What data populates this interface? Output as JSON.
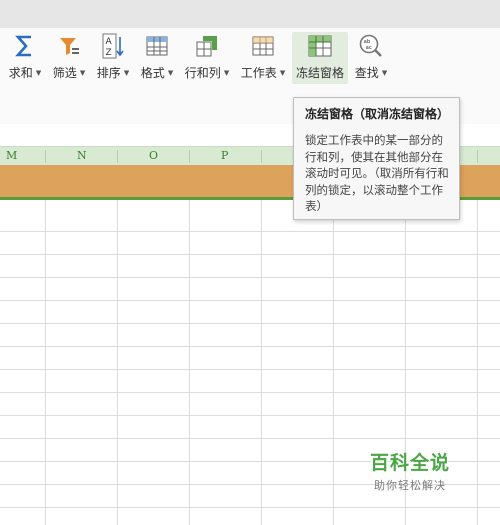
{
  "ribbon": {
    "buttons": [
      {
        "label": "求和",
        "icon": "sigma-icon",
        "dropdown": true
      },
      {
        "label": "筛选",
        "icon": "filter-icon",
        "dropdown": true
      },
      {
        "label": "排序",
        "icon": "sort-az-icon",
        "dropdown": true
      },
      {
        "label": "格式",
        "icon": "format-icon",
        "dropdown": true
      },
      {
        "label": "行和列",
        "icon": "rows-columns-icon",
        "dropdown": true
      },
      {
        "label": "工作表",
        "icon": "worksheet-icon",
        "dropdown": true
      },
      {
        "label": "冻结窗格",
        "icon": "freeze-panes-icon",
        "dropdown": false,
        "active": true
      },
      {
        "label": "查找",
        "icon": "find-icon",
        "dropdown": true
      }
    ]
  },
  "sheet": {
    "columns": [
      "M",
      "N",
      "O",
      "P"
    ]
  },
  "tooltip": {
    "title": "冻结窗格（取消冻结窗格）",
    "body": "锁定工作表中的某一部分的行和列，使其在其他部分在滚动时可见。（取消所有行和列的锁定，以滚动整个工作表）"
  },
  "watermark": {
    "main": "百科全说",
    "sub": "助你轻松解决"
  },
  "colors": {
    "column_header_bg": "#d8ebd2",
    "column_letter": "#3f7a31",
    "frozen_row": "#dda25b",
    "freeze_line": "#5a9c3b",
    "watermark_green": "#4ba646"
  }
}
